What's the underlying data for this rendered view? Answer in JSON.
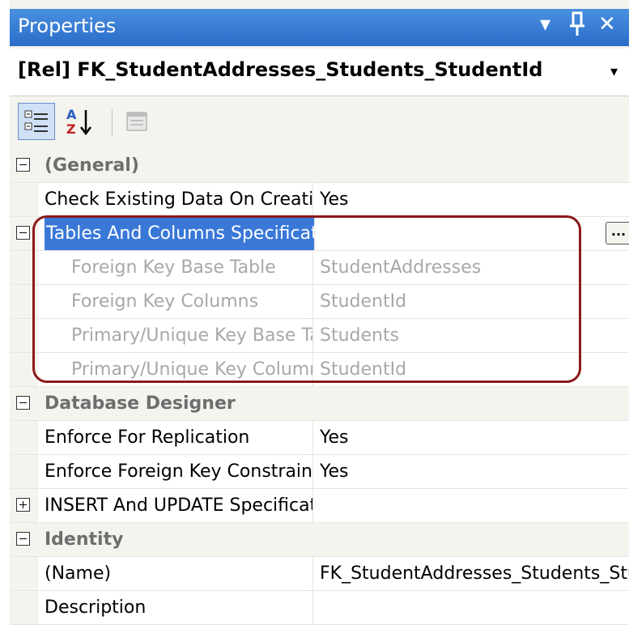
{
  "window": {
    "title": "Properties"
  },
  "object_selector": {
    "value": "[Rel] FK_StudentAddresses_Students_StudentId"
  },
  "properties": [
    {
      "kind": "category",
      "name": "(General)",
      "value": ""
    },
    {
      "kind": "prop",
      "name": "Check Existing Data On Creation Or Re-Enabling",
      "value": "Yes"
    },
    {
      "kind": "group",
      "name": "Tables And Columns Specification",
      "value": ""
    },
    {
      "kind": "sub",
      "name": "Foreign Key Base Table",
      "value": "StudentAddresses"
    },
    {
      "kind": "sub",
      "name": "Foreign Key Columns",
      "value": "StudentId"
    },
    {
      "kind": "sub",
      "name": "Primary/Unique Key Base Table",
      "value": "Students"
    },
    {
      "kind": "sub",
      "name": "Primary/Unique Key Columns",
      "value": "StudentId"
    },
    {
      "kind": "category",
      "name": "Database Designer",
      "value": ""
    },
    {
      "kind": "prop",
      "name": "Enforce For Replication",
      "value": "Yes"
    },
    {
      "kind": "prop",
      "name": "Enforce Foreign Key Constraint",
      "value": "Yes"
    },
    {
      "kind": "collapsed",
      "name": "INSERT And UPDATE Specification",
      "value": ""
    },
    {
      "kind": "category",
      "name": "Identity",
      "value": ""
    },
    {
      "kind": "prop",
      "name": "(Name)",
      "value": "FK_StudentAddresses_Students_StudentId"
    },
    {
      "kind": "prop",
      "name": "Description",
      "value": ""
    }
  ],
  "ellipsis_label": "...",
  "colors": {
    "titlebar": "#2a6cc8",
    "selection": "#3a78d8",
    "highlight_border": "#8b1a1a"
  }
}
